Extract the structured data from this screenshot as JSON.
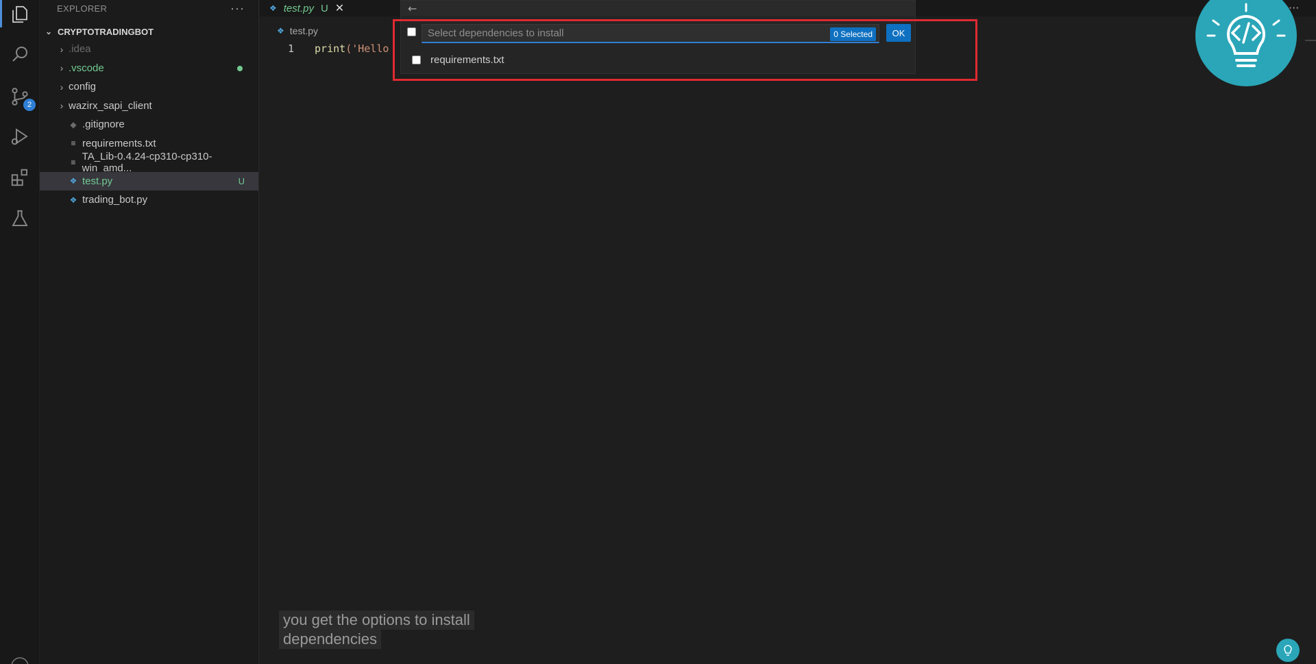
{
  "sidebar": {
    "header": "EXPLORER",
    "more": "···",
    "folder": "CRYPTOTRADINGBOT",
    "items": [
      {
        "label": ".idea",
        "kind": "folder"
      },
      {
        "label": ".vscode",
        "kind": "folder"
      },
      {
        "label": "config",
        "kind": "folder"
      },
      {
        "label": "wazirx_sapi_client",
        "kind": "folder"
      },
      {
        "label": ".gitignore",
        "kind": "file"
      },
      {
        "label": "requirements.txt",
        "kind": "file"
      },
      {
        "label": "TA_Lib-0.4.24-cp310-cp310-win_amd...",
        "kind": "file"
      },
      {
        "label": "test.py",
        "kind": "file",
        "status": "U"
      },
      {
        "label": "trading_bot.py",
        "kind": "file"
      }
    ]
  },
  "activity": {
    "scm_badge": "2"
  },
  "editor": {
    "tab": {
      "label": "test.py",
      "status": "U",
      "close": "✕"
    },
    "breadcrumb": "test.py",
    "line_number": "1",
    "code_fn": "print",
    "code_str": "('Hello"
  },
  "quick_pick": {
    "back": "←",
    "placeholder": "Select dependencies to install",
    "selected_count": "0 Selected",
    "ok_label": "OK",
    "items": [
      {
        "label": "requirements.txt"
      }
    ]
  },
  "caption": {
    "line1": "you get the options to install",
    "line2": "dependencies"
  },
  "top_right_more": "···",
  "colors": {
    "accent": "#0e70c0",
    "git_untracked": "#73c991",
    "highlight": "#e02a31",
    "logo": "#2aa6b8"
  }
}
